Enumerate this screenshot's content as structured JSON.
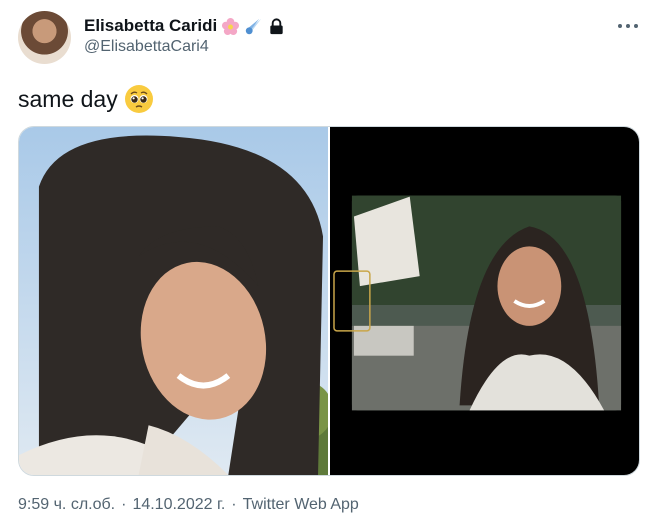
{
  "author": {
    "display_name": "Elisabetta Caridi",
    "handle": "@ElisabettaCari4",
    "name_emojis": [
      "blossom-icon",
      "comet-icon",
      "lock-icon"
    ]
  },
  "tweet": {
    "text": "same day",
    "text_emoji": "pleading-face-emoji"
  },
  "media": {
    "photo_count": 2
  },
  "meta": {
    "time": "9:59 ч. сл.об.",
    "separator": "·",
    "date": "14.10.2022 г.",
    "source": "Twitter Web App"
  },
  "colors": {
    "text_primary": "#0f1419",
    "text_secondary": "#536471",
    "border": "#cfd9de"
  }
}
